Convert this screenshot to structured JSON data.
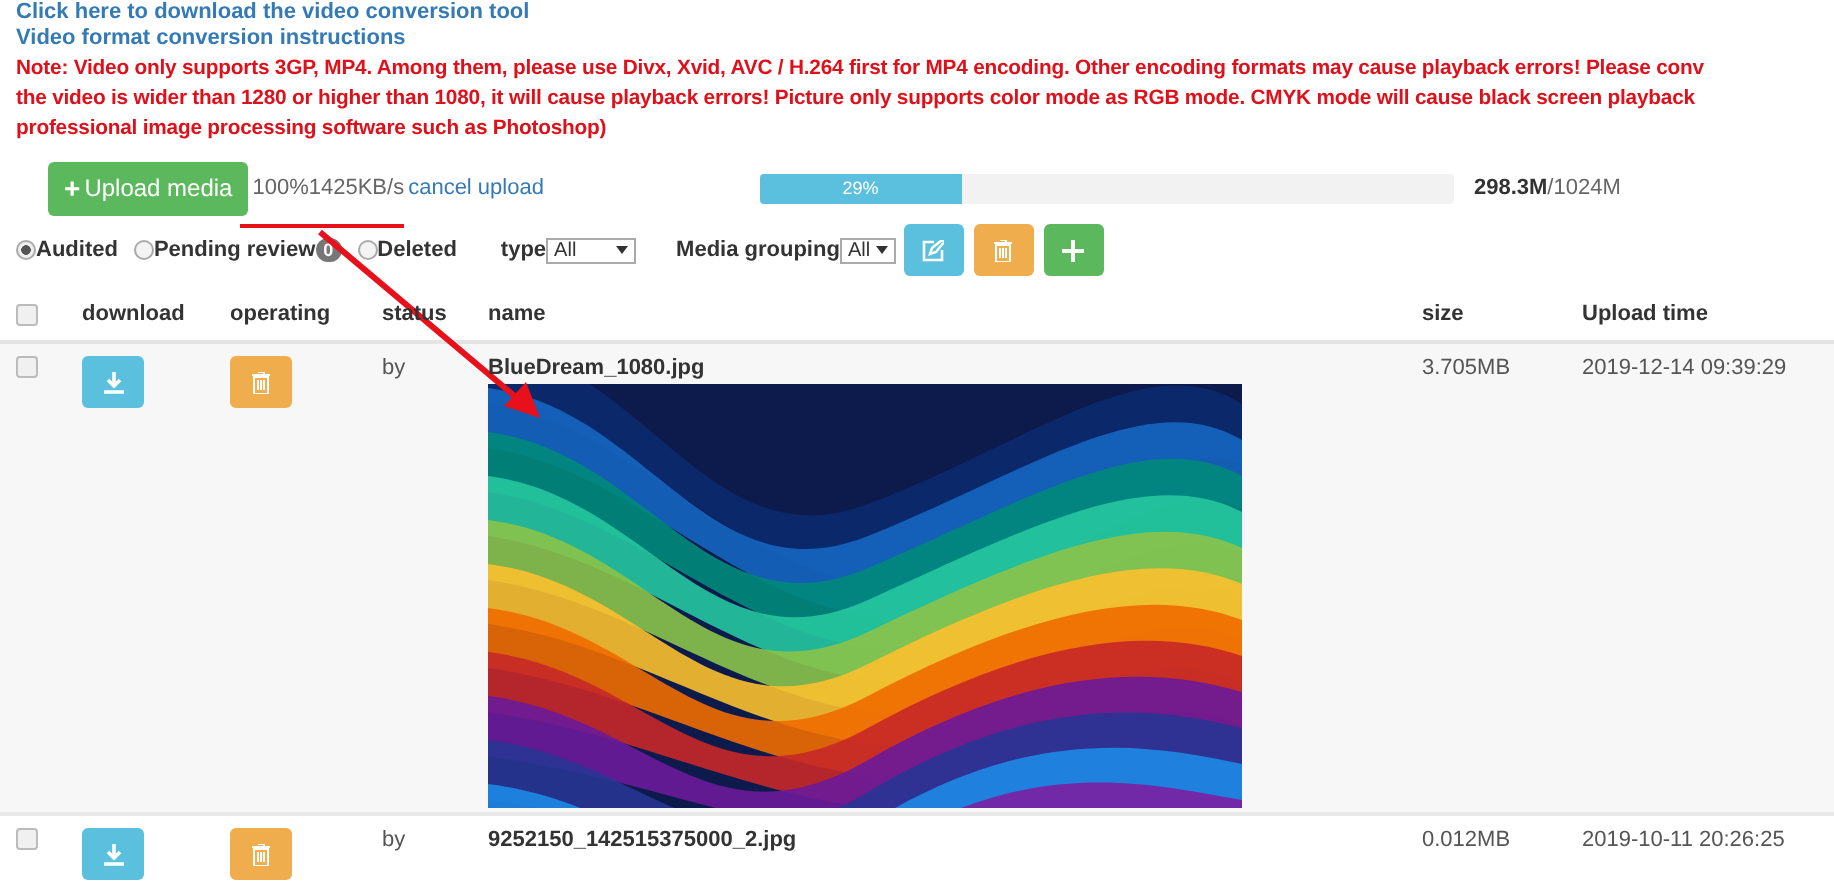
{
  "links": [
    "Click here to download the video conversion tool",
    "Video format conversion instructions"
  ],
  "note_lines": [
    "Note: Video only supports 3GP, MP4. Among them, please use Divx, Xvid, AVC / H.264 first for MP4 encoding. Other encoding formats may cause playback errors! Please conv",
    "the video is wider than 1280 or higher than 1080, it will cause playback errors! Picture only supports color mode as RGB mode. CMYK mode will cause black screen playback",
    "professional image processing software such as Photoshop)"
  ],
  "upload": {
    "button": "Upload media",
    "button_icon": "+",
    "speed": "100%1425KB/s",
    "cancel": "cancel upload",
    "progress_label": "29%",
    "level": 0.29,
    "used": "298.3M",
    "total": "/1024M"
  },
  "filters": {
    "radios": [
      {
        "label": "Audited",
        "selected": true
      },
      {
        "label": "Pending review",
        "selected": false,
        "badge": "0"
      },
      {
        "label": "Deleted",
        "selected": false
      }
    ],
    "type_label": "type",
    "type_value": "All",
    "group_label": "Media grouping",
    "group_value": "All"
  },
  "table": {
    "select_all_checked": false,
    "columns": [
      "download",
      "operating",
      "status",
      "name",
      "size",
      "Upload time"
    ],
    "rows": [
      {
        "checked": false,
        "status": "by",
        "name": "BlueDream_1080.jpg",
        "size": "3.705MB",
        "time": "2019-12-14 09:39:29"
      },
      {
        "checked": false,
        "status": "by",
        "name": "9252150_142515375000_2.jpg",
        "size": "0.012MB",
        "time": "2019-10-11 20:26:25"
      }
    ]
  }
}
